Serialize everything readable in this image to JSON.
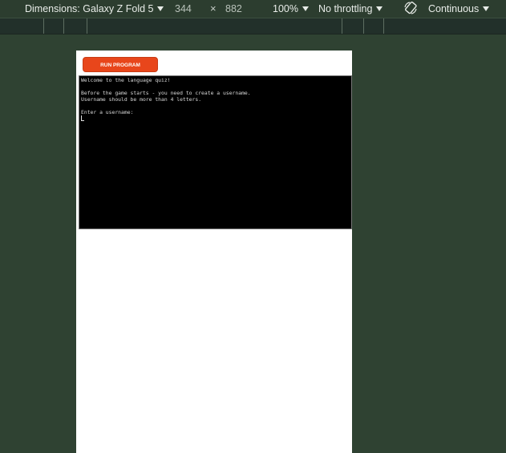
{
  "toolbar": {
    "dimensions_label": "Dimensions: Galaxy Z Fold 5",
    "width_value": "344",
    "separator": "×",
    "height_value": "882",
    "zoom": "100%",
    "throttling": "No throttling",
    "rotate_icon": "rotate-icon",
    "mode": "Continuous"
  },
  "app": {
    "run_button_label": "RUN PROGRAM",
    "terminal": {
      "lines": [
        "Welcome to the language quiz!",
        "",
        "Before the game starts - you need to create a username.",
        "Username should be more than 4 letters.",
        "",
        "Enter a username:"
      ]
    }
  },
  "colors": {
    "page_background": "#2f4232",
    "run_button": "#e8461b",
    "terminal_background": "#000000"
  }
}
